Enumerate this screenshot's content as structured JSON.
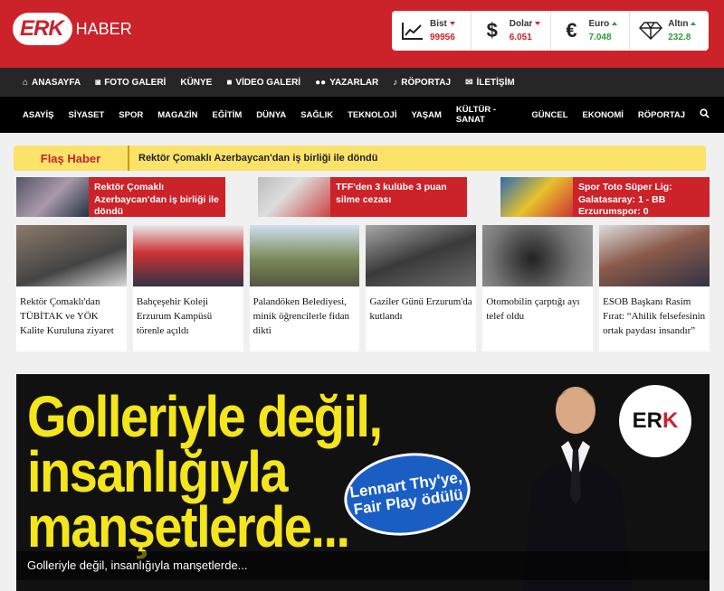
{
  "brand": {
    "logo_erk": "ERK",
    "logo_haber": "HABER"
  },
  "markets": [
    {
      "name": "Bist",
      "value": "99956",
      "trend": "down",
      "icon": "chart-line-icon"
    },
    {
      "name": "Dolar",
      "value": "6.051",
      "trend": "down",
      "icon": "dollar-icon"
    },
    {
      "name": "Euro",
      "value": "7.048",
      "trend": "up",
      "icon": "euro-icon"
    },
    {
      "name": "Altın",
      "value": "232.8",
      "trend": "up",
      "icon": "diamond-icon"
    }
  ],
  "nav_main": [
    {
      "label": "ANASAYFA",
      "icon": "home-icon"
    },
    {
      "label": "FOTO GALERİ",
      "icon": "camera-icon"
    },
    {
      "label": "KÜNYE",
      "icon": ""
    },
    {
      "label": "VİDEO GALERİ",
      "icon": "video-icon"
    },
    {
      "label": "YAZARLAR",
      "icon": "users-icon"
    },
    {
      "label": "RÖPORTAJ",
      "icon": "microphone-icon"
    },
    {
      "label": "İLETİŞİM",
      "icon": "envelope-icon"
    }
  ],
  "nav_categories": [
    "ASAYİŞ",
    "SİYASET",
    "SPOR",
    "MAGAZİN",
    "EĞİTİM",
    "DÜNYA",
    "SAĞLIK",
    "TEKNOLOJİ",
    "YAŞAM",
    "KÜLTÜR - SANAT",
    "GÜNCEL",
    "EKONOMİ",
    "RÖPORTAJ"
  ],
  "flash": {
    "label": "Flaş Haber",
    "text": "Rektör Çomaklı Azerbaycan'dan iş birliği ile döndü"
  },
  "top_news": [
    {
      "title": "Rektör Çomaklı Azerbaycan'dan iş birliği ile döndü"
    },
    {
      "title": "TFF'den 3 kulübe 3 puan silme cezası"
    },
    {
      "title": "Spor Toto Süper Lig: Galatasaray: 1 - BB Erzurumspor: 0"
    }
  ],
  "cards": [
    {
      "title": "Rektör Çomaklı'dan TÜBİTAK ve YÖK Kalite Kuruluna ziyaret"
    },
    {
      "title": "Bahçeşehir Koleji Erzurum Kampüsü törenle açıldı"
    },
    {
      "title": "Palandöken Belediyesi, minik öğrencilerle fidan dikti"
    },
    {
      "title": "Gaziler Günü Erzurum'da kutlandı"
    },
    {
      "title": "Otomobilin çarptığı ayı telef oldu"
    },
    {
      "title": "ESOB Başkanı Rasim Fırat: “Ahilik felsefesinin ortak paydası insandır”"
    }
  ],
  "hero": {
    "headline_line1": "Golleriyle değil,",
    "headline_line2": "insanlığıyla",
    "headline_line3": "manşetlerde...",
    "badge": "Lennart Thy'ye, Fair Play ödülü",
    "logo_erk": "ER",
    "logo_k": "K",
    "caption": "Golleriyle değil, insanlığıyla manşetlerde..."
  },
  "colors": {
    "brand_red": "#cc2229",
    "flash_yellow": "#fbe36a",
    "up_green": "#2e9a3e"
  }
}
